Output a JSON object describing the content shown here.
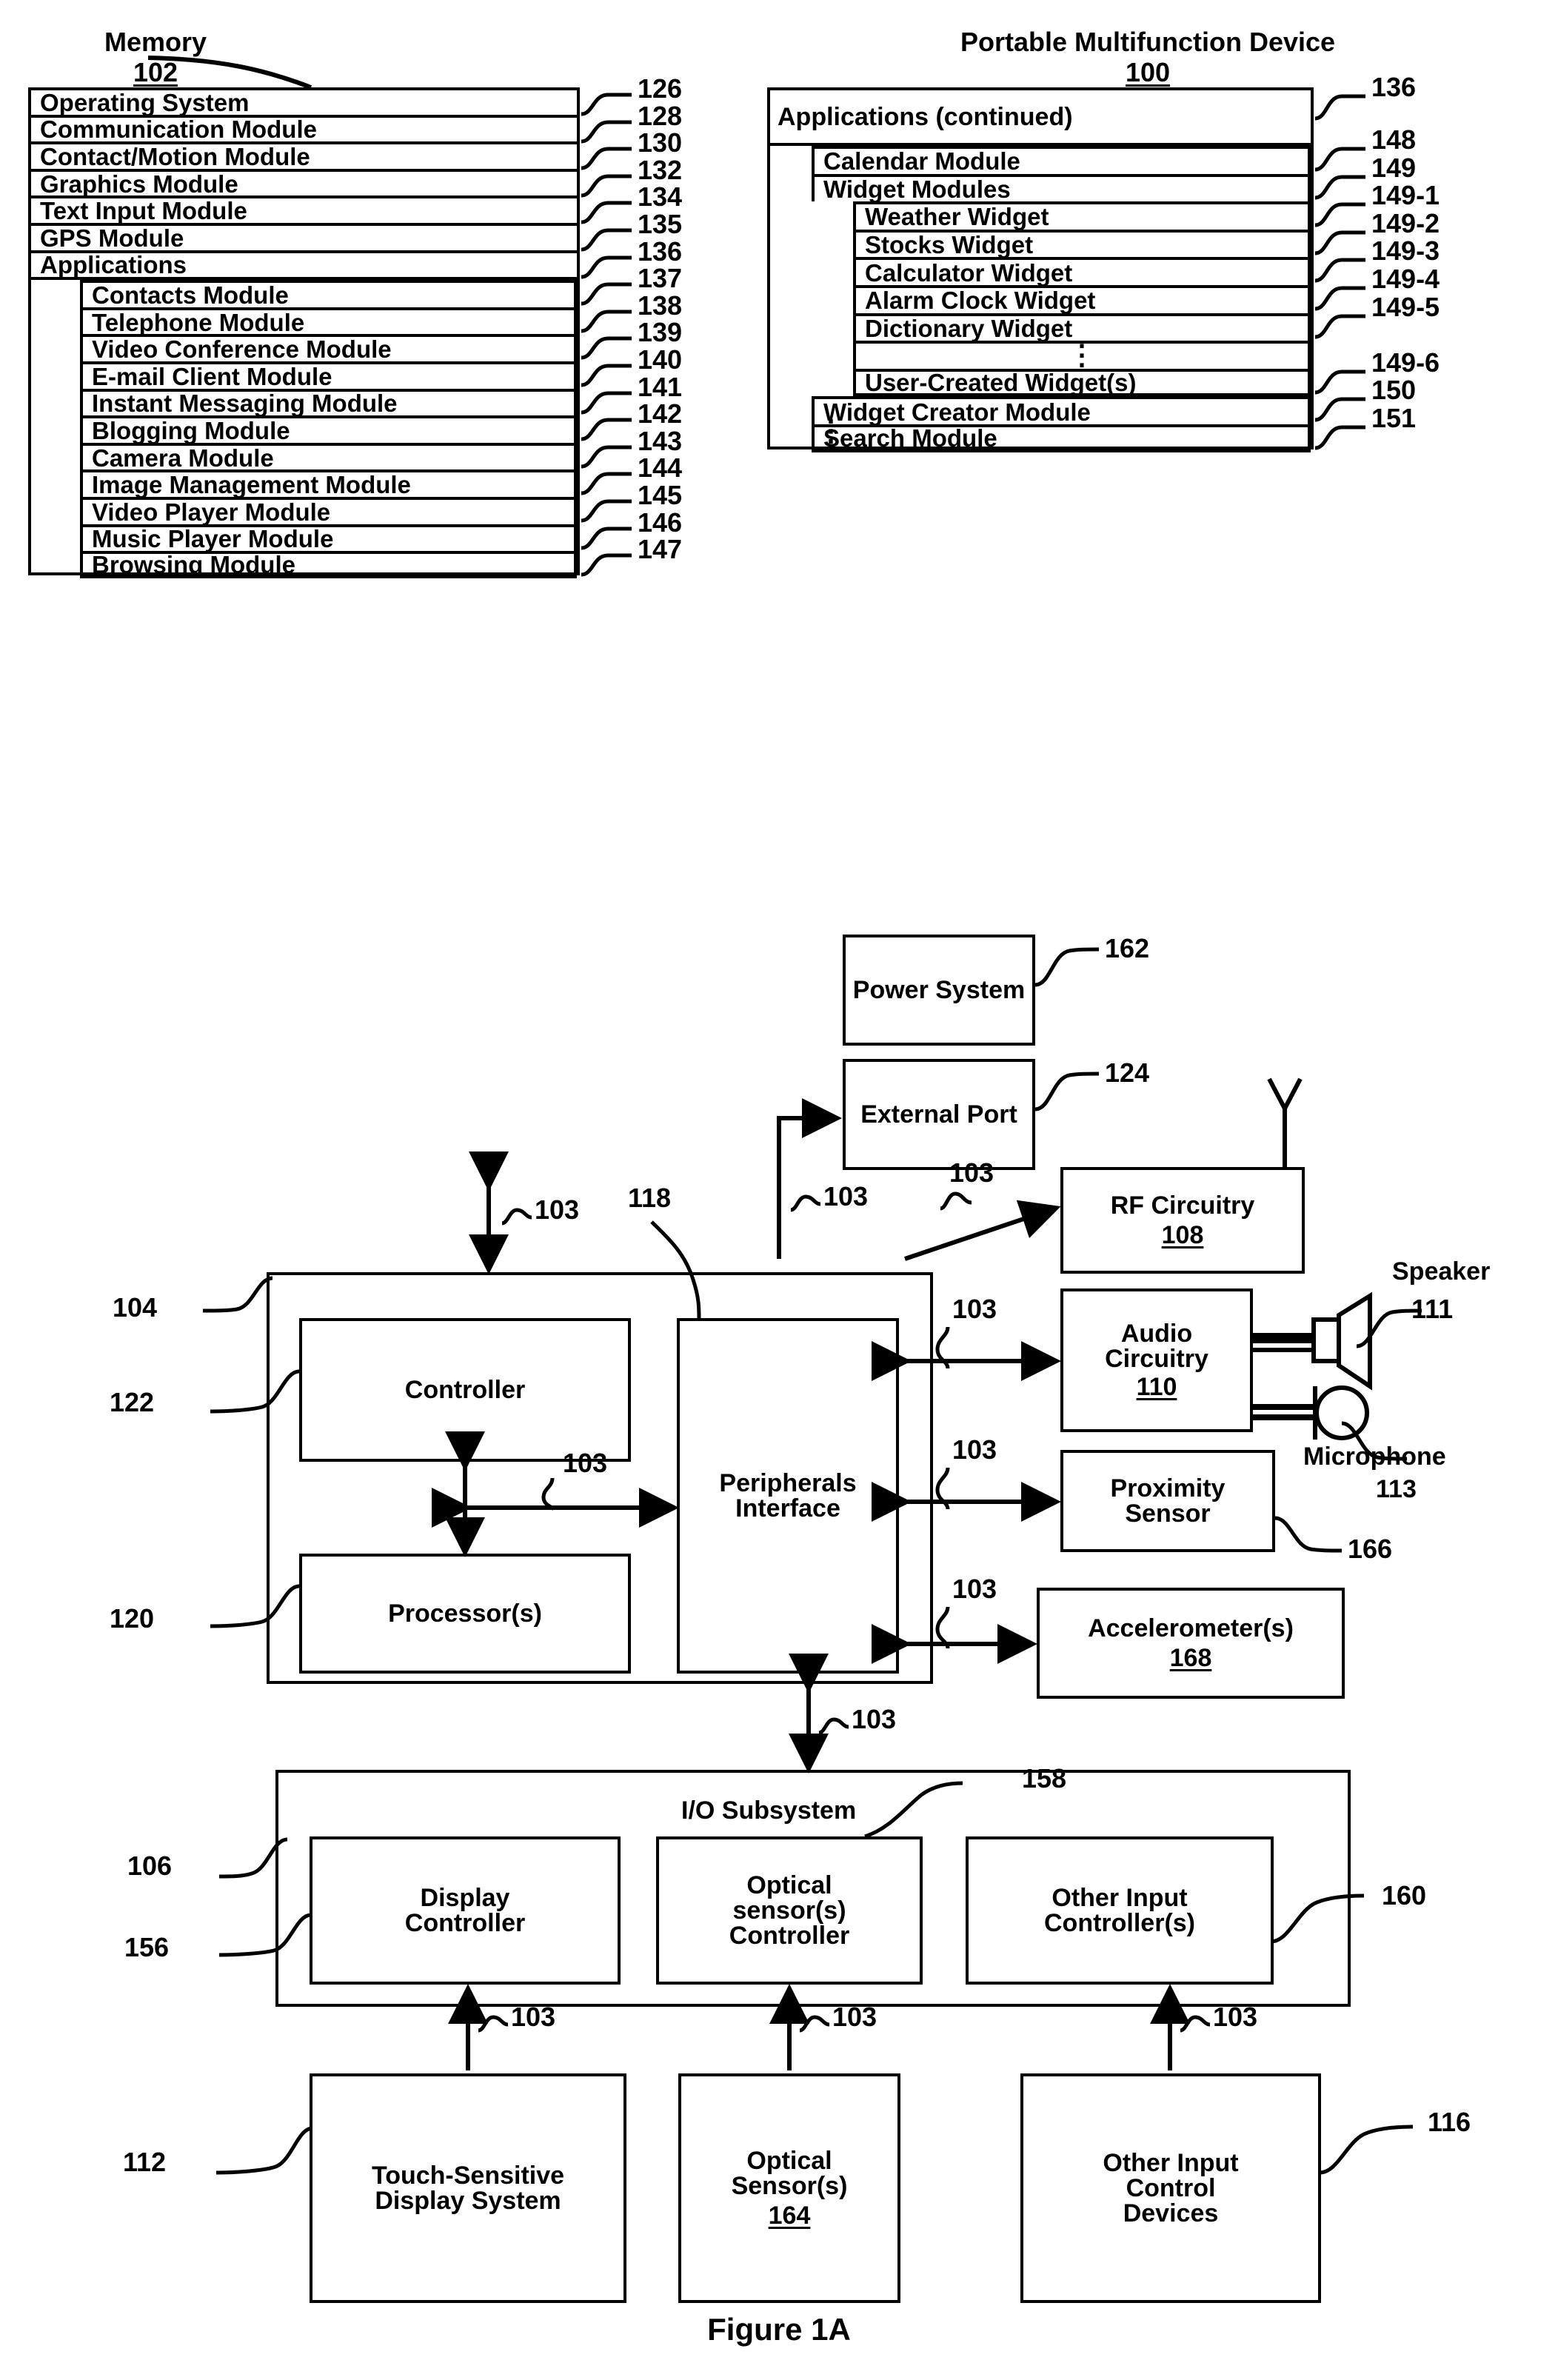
{
  "figure": {
    "caption": "Figure 1A"
  },
  "titles": {
    "memory": {
      "name": "Memory",
      "ref": "102"
    },
    "device": {
      "name": "Portable Multifunction Device",
      "ref": "100"
    }
  },
  "memory_box": {
    "rows": [
      {
        "label": "Operating System",
        "ref": "126",
        "level": 0
      },
      {
        "label": "Communication Module",
        "ref": "128",
        "level": 0
      },
      {
        "label": "Contact/Motion Module",
        "ref": "130",
        "level": 0
      },
      {
        "label": "Graphics Module",
        "ref": "132",
        "level": 0
      },
      {
        "label": "Text Input Module",
        "ref": "134",
        "level": 0
      },
      {
        "label": "GPS Module",
        "ref": "135",
        "level": 0
      },
      {
        "label": "Applications",
        "ref": "136",
        "level": 0
      },
      {
        "label": "Contacts Module",
        "ref": "137",
        "level": 1
      },
      {
        "label": "Telephone Module",
        "ref": "138",
        "level": 1
      },
      {
        "label": "Video Conference Module",
        "ref": "139",
        "level": 1
      },
      {
        "label": "E-mail Client Module",
        "ref": "140",
        "level": 1
      },
      {
        "label": "Instant Messaging Module",
        "ref": "141",
        "level": 1
      },
      {
        "label": "Blogging Module",
        "ref": "142",
        "level": 1
      },
      {
        "label": "Camera Module",
        "ref": "143",
        "level": 1
      },
      {
        "label": "Image Management Module",
        "ref": "144",
        "level": 1
      },
      {
        "label": "Video Player Module",
        "ref": "145",
        "level": 1
      },
      {
        "label": "Music Player Module",
        "ref": "146",
        "level": 1
      },
      {
        "label": "Browsing Module",
        "ref": "147",
        "level": 1
      }
    ]
  },
  "applications_continued_box": {
    "header": {
      "label": "Applications (continued)",
      "ref": "136"
    },
    "rows": [
      {
        "label": "Calendar Module",
        "ref": "148",
        "level": 1
      },
      {
        "label": "Widget Modules",
        "ref": "149",
        "level": 1
      },
      {
        "label": "Weather Widget",
        "ref": "149-1",
        "level": 2
      },
      {
        "label": "Stocks Widget",
        "ref": "149-2",
        "level": 2
      },
      {
        "label": "Calculator Widget",
        "ref": "149-3",
        "level": 2
      },
      {
        "label": "Alarm Clock Widget",
        "ref": "149-4",
        "level": 2
      },
      {
        "label": "Dictionary Widget",
        "ref": "149-5",
        "level": 2
      },
      {
        "label": "⋮",
        "ref": "",
        "level": 2
      },
      {
        "label": "User-Created Widget(s)",
        "ref": "149-6",
        "level": 2
      },
      {
        "label": "Widget Creator Module",
        "ref": "150",
        "level": 1
      },
      {
        "label": "Search Module",
        "ref": "151",
        "level": 1
      }
    ],
    "trailing_ellipsis": "⋮"
  },
  "blocks": {
    "power_system": {
      "label": "Power System",
      "ref": "162"
    },
    "external_port": {
      "label": "External Port",
      "ref": "124"
    },
    "rf_circuitry": {
      "label": "RF Circuitry",
      "ref": "108"
    },
    "audio_circuitry": {
      "label": "Audio Circuitry",
      "ref": "110"
    },
    "speaker": {
      "label": "Speaker",
      "ref": "111"
    },
    "microphone": {
      "label": "Microphone",
      "ref": "113"
    },
    "proximity_sensor": {
      "label": "Proximity Sensor",
      "ref": "166"
    },
    "accelerometers": {
      "label": "Accelerometer(s)",
      "ref": "168"
    },
    "controller": {
      "label": "Controller",
      "ref": "122"
    },
    "processors": {
      "label": "Processor(s)",
      "ref": "120"
    },
    "peripherals_interface": {
      "label": "Peripherals Interface",
      "ref": "118"
    },
    "cpu_group_ref": {
      "ref": "104"
    },
    "io_subsystem": {
      "label": "I/O Subsystem",
      "ref": "106"
    },
    "display_controller": {
      "label": "Display Controller",
      "ref": "156"
    },
    "optical_sensor_controller": {
      "label": "Optical sensor(s) Controller",
      "ref": "158"
    },
    "other_input_controllers": {
      "label": "Other Input Controller(s)",
      "ref": "160"
    },
    "touch_display": {
      "label": "Touch-Sensitive Display System",
      "ref": "112"
    },
    "optical_sensors": {
      "label": "Optical Sensor(s)",
      "ref": "164"
    },
    "other_input_devices": {
      "label": "Other Input Control Devices",
      "ref": "116"
    }
  },
  "bus_label": "103",
  "bus_labels": [
    "103",
    "103",
    "103",
    "103",
    "103",
    "103",
    "103",
    "103",
    "103",
    "103",
    "103",
    "103"
  ]
}
